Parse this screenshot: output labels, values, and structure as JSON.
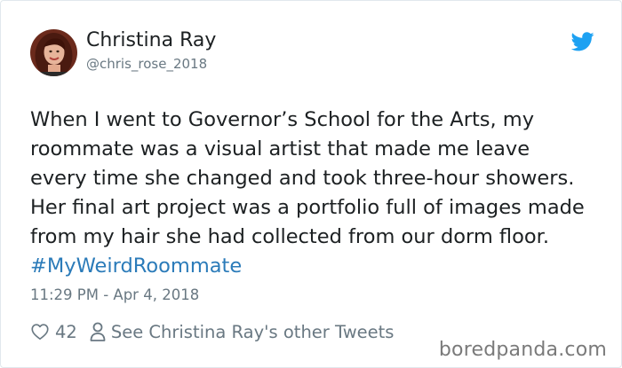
{
  "author": {
    "display_name": "Christina Ray",
    "handle": "@chris_rose_2018"
  },
  "tweet": {
    "text": "When I went to Governor’s School for the Arts, my roommate was a visual artist that made me leave every time she changed and took three-hour showers. Her final art project was a portfolio full of images made from my hair she had collected from our dorm floor.",
    "hashtag": "#MyWeirdRoommate",
    "timestamp": "11:29 PM - Apr 4, 2018"
  },
  "actions": {
    "like_count": "42",
    "profile_link": "See Christina Ray's other Tweets"
  },
  "watermark": "boredpanda.com",
  "icons": {
    "brand": "twitter-bird-icon",
    "like": "heart-icon",
    "profile": "person-icon"
  },
  "colors": {
    "twitter_blue": "#1da1f2",
    "link_blue": "#2b7bb9",
    "muted_gray": "#697882"
  }
}
